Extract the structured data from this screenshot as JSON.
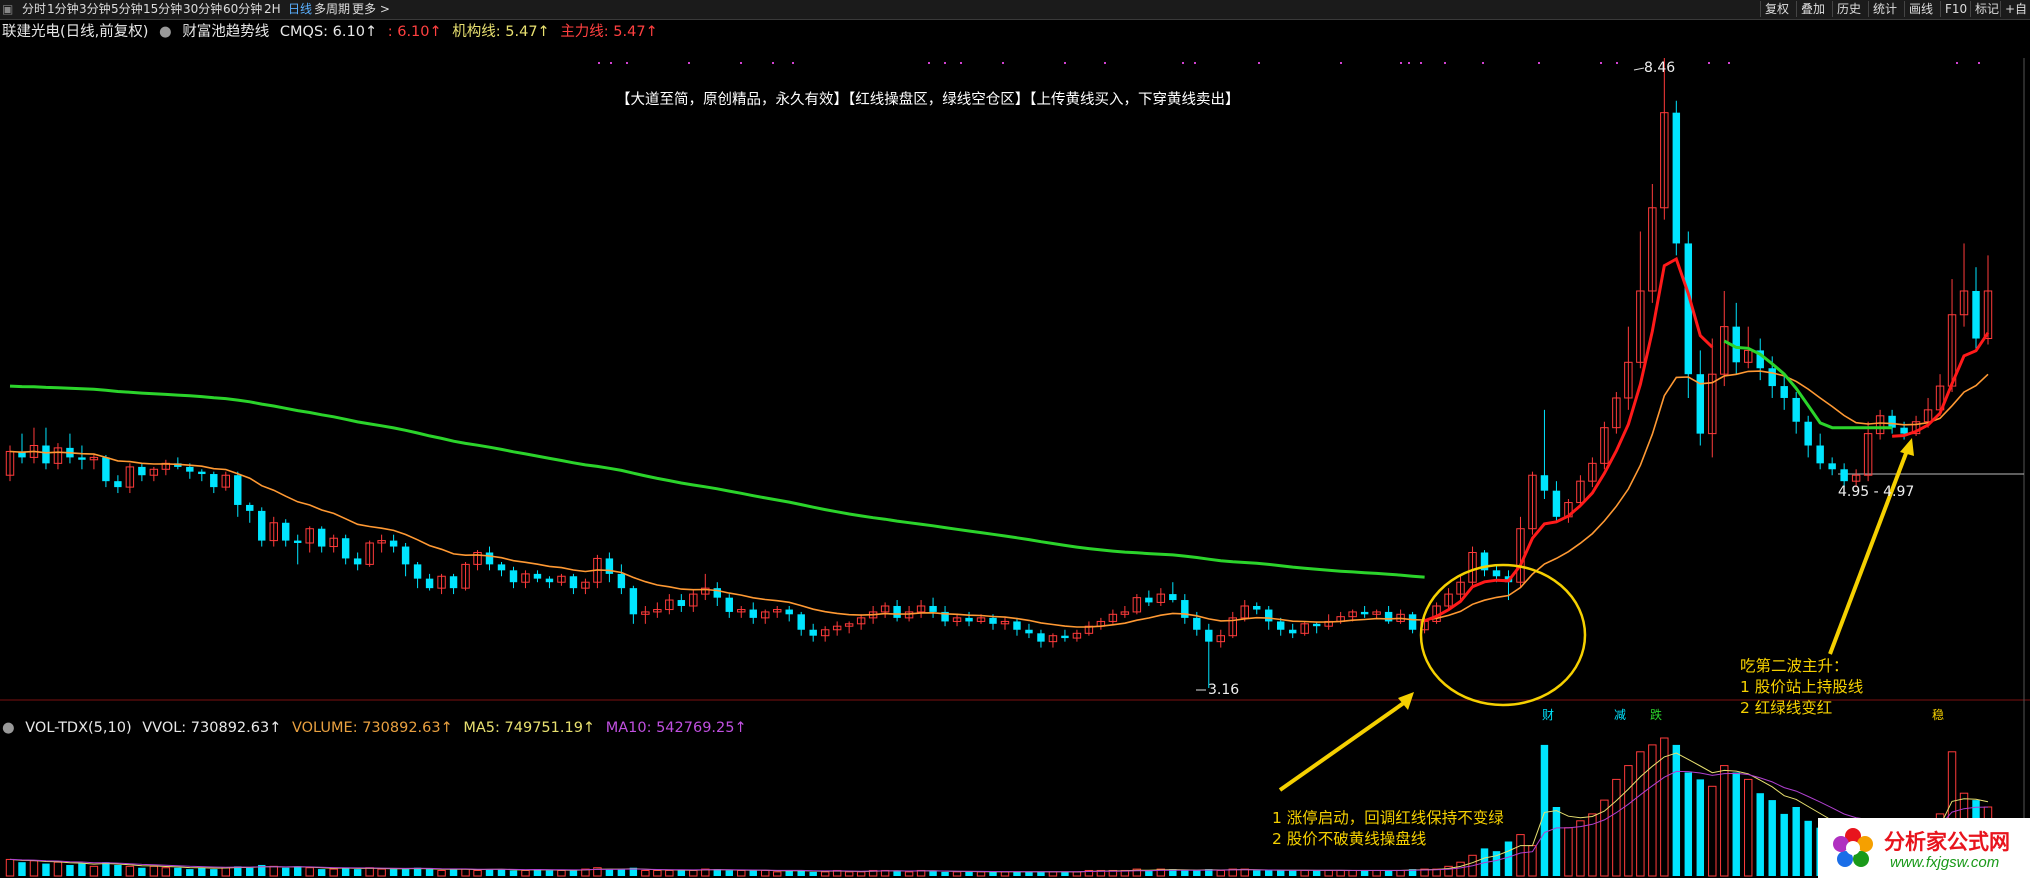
{
  "toolbar": {
    "periods": [
      "分时",
      "1分钟",
      "3分钟",
      "5分钟",
      "15分钟",
      "30分钟",
      "60分钟",
      "2H",
      "日线",
      "多周期",
      "更多 >"
    ],
    "active_period": "日线",
    "right_buttons": [
      "复权",
      "叠加",
      "历史",
      "统计",
      "画线",
      "F10",
      "标记",
      "+自"
    ]
  },
  "header": {
    "stock_name": "联建光电(日线,前复权)",
    "indicator_name": "财富池趋势线",
    "cmqs": "CMQS: 6.10↑",
    "cmqs2": ": 6.10↑",
    "jigou": "机构线: 5.47↑",
    "zhuli": "主力线: 5.47↑"
  },
  "slogan": "【大道至简，原创精品，永久有效】【红线操盘区，绿线空仓区】【上传黄线买入，下穿黄线卖出】",
  "labels": {
    "high": "8.46",
    "low": "3.16",
    "range": "4.95 - 4.97"
  },
  "events": [
    "财",
    "减",
    "跌",
    "稳"
  ],
  "annotation1": {
    "line1": "1 涨停启动，回调红线保持不变绿",
    "line2": "2 股价不破黄线操盘线"
  },
  "annotation2": {
    "line0": "吃第二波主升：",
    "line1": "1 股价站上持股线",
    "line2": "2 红绿线变红"
  },
  "volume_header": {
    "name": "VOL-TDX(5,10)",
    "vvol": "VVOL: 730892.63↑",
    "volume": "VOLUME: 730892.63↑",
    "ma5": "MA5: 749751.19↑",
    "ma10": "MA10: 542769.25↑"
  },
  "watermark": {
    "text": "分析家公式网",
    "url": "www.fxjgsw.com"
  },
  "colors": {
    "up": "#ff3b3b",
    "down": "#00e5ff",
    "green_line": "#2bd42b",
    "red_line": "#ff1a1a",
    "orange_line": "#ff9933",
    "annotation": "#f5d000",
    "ma10": "#b040d0"
  },
  "chart_data": {
    "type": "candlestick",
    "price_range": [
      3.0,
      8.6
    ],
    "annotated_high": 8.46,
    "annotated_low": 3.16,
    "candles": [
      [
        4.95,
        5.15,
        5.2,
        4.9
      ],
      [
        5.15,
        5.1,
        5.3,
        5.05
      ],
      [
        5.1,
        5.2,
        5.35,
        5.05
      ],
      [
        5.2,
        5.05,
        5.35,
        5.0
      ],
      [
        5.05,
        5.18,
        5.22,
        5.0
      ],
      [
        5.18,
        5.1,
        5.3,
        5.05
      ],
      [
        5.1,
        5.08,
        5.2,
        5.0
      ],
      [
        5.08,
        5.1,
        5.12,
        5.0
      ],
      [
        5.1,
        4.9,
        5.12,
        4.85
      ],
      [
        4.9,
        4.85,
        4.95,
        4.8
      ],
      [
        4.85,
        5.02,
        5.05,
        4.8
      ],
      [
        5.02,
        4.95,
        5.05,
        4.9
      ],
      [
        4.95,
        5.0,
        5.02,
        4.9
      ],
      [
        5.0,
        5.05,
        5.08,
        4.95
      ],
      [
        5.05,
        5.02,
        5.1,
        5.0
      ],
      [
        5.02,
        4.98,
        5.05,
        4.92
      ],
      [
        4.98,
        4.96,
        5.0,
        4.9
      ],
      [
        4.96,
        4.85,
        4.98,
        4.8
      ],
      [
        4.85,
        4.95,
        4.98,
        4.82
      ],
      [
        4.95,
        4.7,
        4.98,
        4.6
      ],
      [
        4.7,
        4.65,
        4.72,
        4.55
      ],
      [
        4.65,
        4.4,
        4.68,
        4.35
      ],
      [
        4.4,
        4.55,
        4.6,
        4.35
      ],
      [
        4.55,
        4.4,
        4.58,
        4.35
      ],
      [
        4.4,
        4.38,
        4.45,
        4.2
      ],
      [
        4.38,
        4.5,
        4.52,
        4.3
      ],
      [
        4.5,
        4.35,
        4.52,
        4.3
      ],
      [
        4.35,
        4.42,
        4.45,
        4.3
      ],
      [
        4.42,
        4.25,
        4.45,
        4.2
      ],
      [
        4.25,
        4.2,
        4.3,
        4.15
      ],
      [
        4.2,
        4.38,
        4.4,
        4.18
      ],
      [
        4.38,
        4.4,
        4.45,
        4.3
      ],
      [
        4.4,
        4.35,
        4.45,
        4.3
      ],
      [
        4.35,
        4.2,
        4.38,
        4.1
      ],
      [
        4.2,
        4.08,
        4.22,
        4.0
      ],
      [
        4.08,
        4.0,
        4.12,
        3.98
      ],
      [
        4.0,
        4.1,
        4.12,
        3.95
      ],
      [
        4.1,
        4.0,
        4.12,
        3.95
      ],
      [
        4.0,
        4.2,
        4.22,
        3.98
      ],
      [
        4.2,
        4.3,
        4.32,
        4.15
      ],
      [
        4.3,
        4.2,
        4.35,
        4.15
      ],
      [
        4.2,
        4.15,
        4.22,
        4.1
      ],
      [
        4.15,
        4.05,
        4.18,
        4.0
      ],
      [
        4.05,
        4.12,
        4.15,
        4.0
      ],
      [
        4.12,
        4.08,
        4.15,
        4.05
      ],
      [
        4.08,
        4.05,
        4.1,
        4.0
      ],
      [
        4.05,
        4.1,
        4.12,
        4.02
      ],
      [
        4.1,
        4.0,
        4.12,
        3.95
      ],
      [
        4.0,
        4.05,
        4.08,
        3.95
      ],
      [
        4.05,
        4.25,
        4.28,
        4.0
      ],
      [
        4.25,
        4.12,
        4.3,
        4.05
      ],
      [
        4.12,
        4.0,
        4.2,
        3.95
      ],
      [
        4.0,
        3.78,
        4.02,
        3.7
      ],
      [
        3.78,
        3.8,
        3.85,
        3.7
      ],
      [
        3.8,
        3.82,
        3.88,
        3.75
      ],
      [
        3.82,
        3.9,
        3.95,
        3.78
      ],
      [
        3.9,
        3.85,
        3.95,
        3.8
      ],
      [
        3.85,
        3.95,
        3.98,
        3.8
      ],
      [
        3.95,
        4.0,
        4.12,
        3.9
      ],
      [
        4.0,
        3.92,
        4.05,
        3.85
      ],
      [
        3.92,
        3.8,
        3.95,
        3.75
      ],
      [
        3.8,
        3.82,
        3.85,
        3.75
      ],
      [
        3.82,
        3.75,
        3.88,
        3.7
      ],
      [
        3.75,
        3.8,
        3.82,
        3.7
      ],
      [
        3.8,
        3.82,
        3.85,
        3.75
      ],
      [
        3.82,
        3.78,
        3.85,
        3.72
      ],
      [
        3.78,
        3.65,
        3.8,
        3.6
      ],
      [
        3.65,
        3.6,
        3.7,
        3.55
      ],
      [
        3.6,
        3.65,
        3.68,
        3.55
      ],
      [
        3.65,
        3.68,
        3.72,
        3.6
      ],
      [
        3.68,
        3.7,
        3.72,
        3.62
      ],
      [
        3.7,
        3.75,
        3.78,
        3.65
      ],
      [
        3.75,
        3.8,
        3.85,
        3.7
      ],
      [
        3.8,
        3.85,
        3.88,
        3.75
      ],
      [
        3.85,
        3.75,
        3.9,
        3.72
      ],
      [
        3.75,
        3.8,
        3.85,
        3.72
      ],
      [
        3.8,
        3.85,
        3.9,
        3.75
      ],
      [
        3.85,
        3.8,
        3.92,
        3.75
      ],
      [
        3.8,
        3.72,
        3.85,
        3.68
      ],
      [
        3.72,
        3.75,
        3.78,
        3.68
      ],
      [
        3.75,
        3.72,
        3.8,
        3.68
      ],
      [
        3.72,
        3.75,
        3.78,
        3.7
      ],
      [
        3.75,
        3.7,
        3.78,
        3.65
      ],
      [
        3.7,
        3.72,
        3.75,
        3.65
      ],
      [
        3.72,
        3.65,
        3.75,
        3.6
      ],
      [
        3.65,
        3.62,
        3.7,
        3.58
      ],
      [
        3.62,
        3.55,
        3.65,
        3.5
      ],
      [
        3.55,
        3.6,
        3.62,
        3.5
      ],
      [
        3.6,
        3.58,
        3.65,
        3.55
      ],
      [
        3.58,
        3.62,
        3.65,
        3.55
      ],
      [
        3.62,
        3.68,
        3.72,
        3.6
      ],
      [
        3.68,
        3.72,
        3.75,
        3.65
      ],
      [
        3.72,
        3.78,
        3.82,
        3.7
      ],
      [
        3.78,
        3.8,
        3.85,
        3.75
      ],
      [
        3.8,
        3.92,
        3.95,
        3.78
      ],
      [
        3.92,
        3.88,
        3.98,
        3.85
      ],
      [
        3.88,
        3.95,
        4.0,
        3.85
      ],
      [
        3.95,
        3.9,
        4.05,
        3.88
      ],
      [
        3.9,
        3.75,
        3.95,
        3.7
      ],
      [
        3.75,
        3.65,
        3.8,
        3.6
      ],
      [
        3.65,
        3.55,
        3.7,
        3.16
      ],
      [
        3.55,
        3.6,
        3.65,
        3.5
      ],
      [
        3.6,
        3.75,
        3.8,
        3.58
      ],
      [
        3.75,
        3.85,
        3.9,
        3.72
      ],
      [
        3.85,
        3.82,
        3.88,
        3.78
      ],
      [
        3.82,
        3.72,
        3.85,
        3.65
      ],
      [
        3.72,
        3.65,
        3.75,
        3.6
      ],
      [
        3.65,
        3.62,
        3.7,
        3.58
      ],
      [
        3.62,
        3.7,
        3.72,
        3.6
      ],
      [
        3.7,
        3.68,
        3.72,
        3.62
      ],
      [
        3.68,
        3.72,
        3.78,
        3.65
      ],
      [
        3.72,
        3.76,
        3.8,
        3.7
      ],
      [
        3.76,
        3.8,
        3.82,
        3.72
      ],
      [
        3.8,
        3.78,
        3.85,
        3.75
      ],
      [
        3.78,
        3.8,
        3.82,
        3.74
      ],
      [
        3.8,
        3.72,
        3.85,
        3.7
      ],
      [
        3.72,
        3.78,
        3.82,
        3.7
      ],
      [
        3.78,
        3.65,
        3.8,
        3.62
      ],
      [
        3.65,
        3.72,
        3.75,
        3.62
      ],
      [
        3.72,
        3.85,
        3.88,
        3.7
      ],
      [
        3.85,
        3.95,
        4.0,
        3.82
      ],
      [
        3.95,
        4.05,
        4.1,
        3.9
      ],
      [
        4.05,
        4.3,
        4.35,
        4.0
      ],
      [
        4.3,
        4.15,
        4.32,
        4.1
      ],
      [
        4.15,
        4.1,
        4.2,
        4.05
      ],
      [
        4.1,
        4.05,
        4.15,
        3.9
      ],
      [
        4.05,
        4.5,
        4.6,
        4.0
      ],
      [
        4.5,
        4.95,
        4.98,
        4.45
      ],
      [
        4.95,
        4.82,
        5.5,
        4.75
      ],
      [
        4.82,
        4.6,
        4.9,
        4.55
      ],
      [
        4.6,
        4.72,
        4.75,
        4.55
      ],
      [
        4.72,
        4.9,
        4.95,
        4.68
      ],
      [
        4.9,
        5.05,
        5.1,
        4.85
      ],
      [
        5.05,
        5.35,
        5.4,
        5.0
      ],
      [
        5.35,
        5.6,
        5.65,
        5.3
      ],
      [
        5.6,
        5.9,
        6.2,
        5.5
      ],
      [
        5.9,
        6.5,
        7.0,
        5.85
      ],
      [
        6.5,
        7.2,
        7.4,
        6.4
      ],
      [
        7.2,
        8.0,
        8.46,
        7.1
      ],
      [
        8.0,
        6.9,
        8.1,
        6.8
      ],
      [
        6.9,
        5.8,
        7.0,
        5.6
      ],
      [
        5.8,
        5.3,
        6.0,
        5.2
      ],
      [
        5.3,
        5.8,
        6.1,
        5.1
      ],
      [
        5.8,
        6.2,
        6.5,
        5.7
      ],
      [
        6.2,
        5.9,
        6.4,
        5.8
      ],
      [
        5.9,
        6.0,
        6.2,
        5.85
      ],
      [
        6.0,
        5.85,
        6.1,
        5.75
      ],
      [
        5.85,
        5.7,
        5.95,
        5.6
      ],
      [
        5.7,
        5.6,
        5.8,
        5.5
      ],
      [
        5.6,
        5.4,
        5.65,
        5.3
      ],
      [
        5.4,
        5.2,
        5.45,
        5.1
      ],
      [
        5.2,
        5.05,
        5.3,
        5.0
      ],
      [
        5.05,
        5.0,
        5.1,
        4.95
      ],
      [
        5.0,
        4.9,
        5.05,
        4.85
      ],
      [
        4.9,
        4.95,
        5.0,
        4.85
      ],
      [
        4.95,
        5.3,
        5.4,
        4.9
      ],
      [
        5.3,
        5.45,
        5.5,
        5.25
      ],
      [
        5.45,
        5.35,
        5.5,
        5.3
      ],
      [
        5.35,
        5.3,
        5.4,
        5.25
      ],
      [
        5.3,
        5.4,
        5.45,
        5.28
      ],
      [
        5.4,
        5.5,
        5.6,
        5.35
      ],
      [
        5.5,
        5.7,
        5.8,
        5.45
      ],
      [
        5.7,
        6.3,
        6.6,
        5.65
      ],
      [
        6.3,
        6.5,
        6.9,
        6.2
      ],
      [
        6.5,
        6.1,
        6.7,
        6.0
      ],
      [
        6.1,
        6.5,
        6.8,
        6.05
      ]
    ],
    "volume": [
      0.12,
      0.1,
      0.11,
      0.09,
      0.1,
      0.08,
      0.09,
      0.07,
      0.1,
      0.08,
      0.07,
      0.06,
      0.07,
      0.06,
      0.06,
      0.05,
      0.06,
      0.05,
      0.06,
      0.07,
      0.06,
      0.08,
      0.07,
      0.06,
      0.07,
      0.06,
      0.05,
      0.05,
      0.06,
      0.05,
      0.06,
      0.05,
      0.05,
      0.05,
      0.06,
      0.05,
      0.04,
      0.05,
      0.05,
      0.04,
      0.05,
      0.05,
      0.04,
      0.04,
      0.05,
      0.04,
      0.04,
      0.04,
      0.05,
      0.06,
      0.05,
      0.05,
      0.06,
      0.04,
      0.04,
      0.04,
      0.04,
      0.04,
      0.05,
      0.05,
      0.04,
      0.04,
      0.04,
      0.04,
      0.03,
      0.04,
      0.04,
      0.03,
      0.03,
      0.04,
      0.03,
      0.03,
      0.04,
      0.04,
      0.04,
      0.03,
      0.04,
      0.04,
      0.03,
      0.03,
      0.03,
      0.03,
      0.03,
      0.03,
      0.03,
      0.03,
      0.03,
      0.03,
      0.03,
      0.03,
      0.04,
      0.04,
      0.04,
      0.04,
      0.05,
      0.04,
      0.05,
      0.05,
      0.04,
      0.04,
      0.05,
      0.04,
      0.05,
      0.05,
      0.04,
      0.04,
      0.04,
      0.04,
      0.04,
      0.04,
      0.04,
      0.04,
      0.04,
      0.04,
      0.04,
      0.04,
      0.04,
      0.05,
      0.05,
      0.05,
      0.07,
      0.1,
      0.15,
      0.2,
      0.18,
      0.25,
      0.3,
      0.22,
      0.95,
      0.5,
      0.35,
      0.4,
      0.45,
      0.55,
      0.7,
      0.8,
      0.9,
      0.95,
      1.0,
      0.95,
      0.75,
      0.7,
      0.65,
      0.8,
      0.75,
      0.7,
      0.6,
      0.55,
      0.45,
      0.5,
      0.4,
      0.35,
      0.3,
      0.25,
      0.3,
      0.35,
      0.32,
      0.3,
      0.28,
      0.3,
      0.35,
      0.45,
      0.9,
      0.6,
      0.55,
      0.5
    ]
  }
}
